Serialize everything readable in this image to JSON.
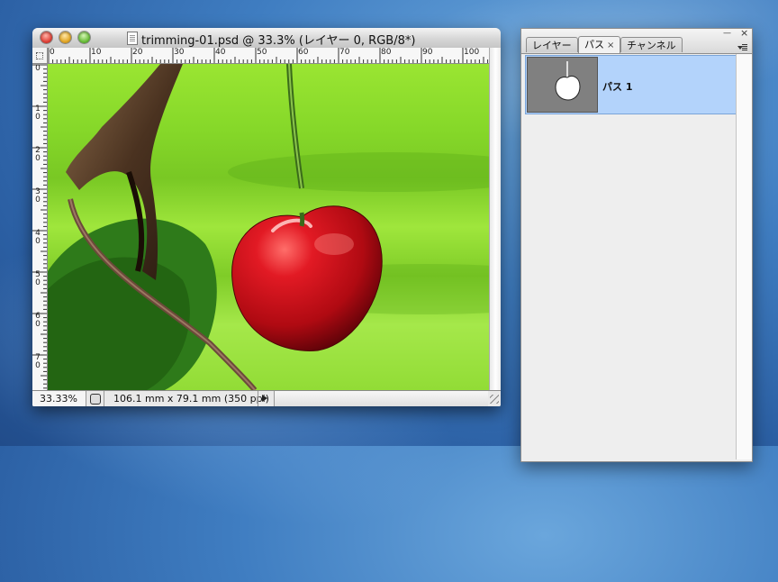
{
  "window": {
    "title": "trimming-01.psd @ 33.3% (レイヤー 0, RGB/8*)"
  },
  "rulers": {
    "horizontal_ticks": [
      "0",
      "10",
      "20",
      "30",
      "40",
      "50",
      "60",
      "70",
      "80",
      "90",
      "100"
    ],
    "vertical_ticks": [
      "0",
      "1 0",
      "2 0",
      "3 0",
      "4 0",
      "5 0",
      "6 0",
      "7 0"
    ]
  },
  "statusbar": {
    "zoom": "33.33%",
    "doc_info": "106.1 mm x 79.1 mm (350 ppi)"
  },
  "panel": {
    "tabs": [
      {
        "label": "レイヤー",
        "active": false
      },
      {
        "label": "パス",
        "active": true
      },
      {
        "label": "チャンネル",
        "active": false
      }
    ],
    "tab_close": "×",
    "window_minimize": "—",
    "window_close": "×",
    "paths": [
      {
        "name": "パス 1",
        "selected": true
      }
    ]
  },
  "colors": {
    "selection_row": "#b3d3fb",
    "cherry_red": "#c8101a",
    "background_green": "#8ee62a"
  }
}
